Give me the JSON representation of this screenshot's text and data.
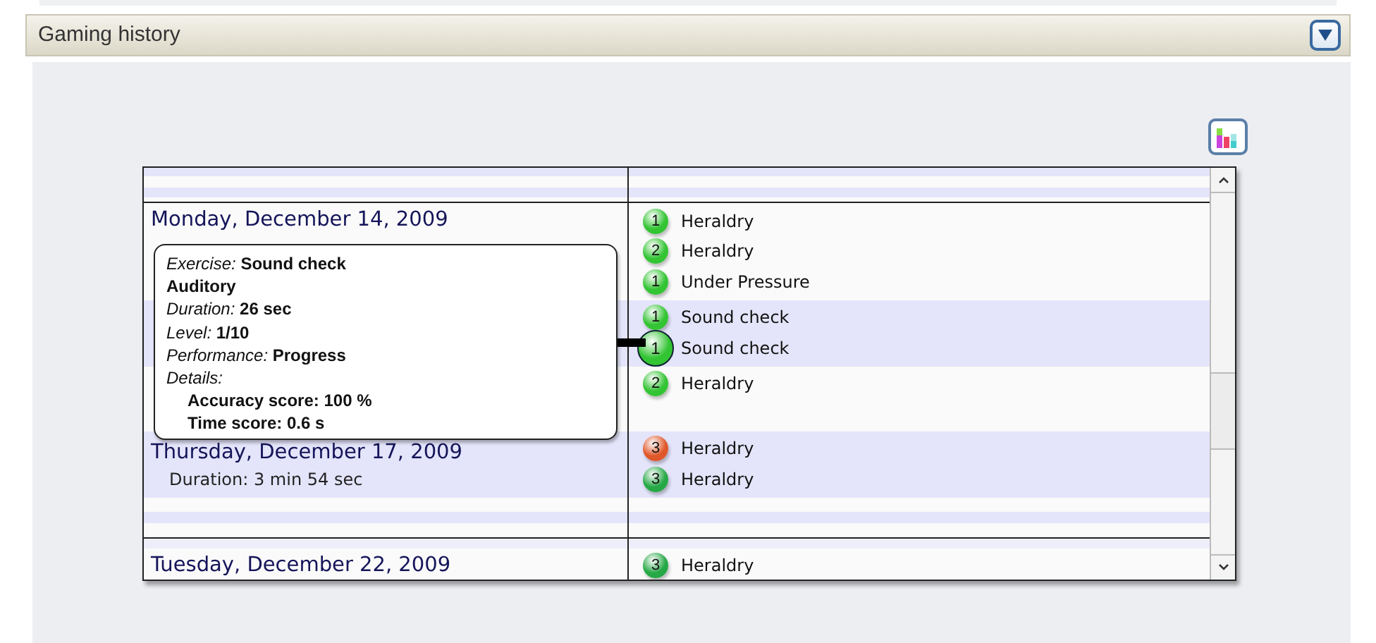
{
  "panel": {
    "title": "Gaming history",
    "expanded": true
  },
  "weeks": [
    {
      "days": [
        {
          "shaded": false,
          "date": "Monday, December 14, 2009",
          "exercises": [
            {
              "level": "1",
              "color": "#33c433",
              "name": "Heraldry",
              "selected": false
            },
            {
              "level": "2",
              "color": "#33c433",
              "name": "Heraldry",
              "selected": false
            },
            {
              "level": "1",
              "color": "#33c433",
              "name": "Under Pressure",
              "selected": false
            }
          ]
        },
        {
          "shaded": true,
          "exercises": [
            {
              "level": "1",
              "color": "#33c433",
              "name": "Sound check",
              "selected": false
            },
            {
              "level": "1",
              "color": "#33c433",
              "name": "Sound check",
              "selected": true
            }
          ]
        },
        {
          "shaded": false,
          "exercises": [
            {
              "level": "2",
              "color": "#33c433",
              "name": "Heraldry",
              "selected": false
            }
          ]
        },
        {
          "shaded": true,
          "date": "Thursday, December 17, 2009",
          "duration": "Duration: 3 min 54 sec",
          "exercises": [
            {
              "level": "3",
              "color": "#e0572a",
              "name": "Heraldry",
              "selected": false
            },
            {
              "level": "3",
              "color": "#25a845",
              "name": "Heraldry",
              "selected": false
            }
          ]
        }
      ]
    },
    {
      "days": [
        {
          "shaded": false,
          "date": "Tuesday, December 22, 2009",
          "exercises": [
            {
              "level": "3",
              "color": "#25a845",
              "name": "Heraldry",
              "selected": false
            }
          ]
        }
      ]
    }
  ],
  "tooltip": {
    "lines": [
      {
        "kind": "field",
        "label": "Exercise:",
        "value": "Sound check"
      },
      {
        "kind": "category",
        "text": "Auditory"
      },
      {
        "kind": "field",
        "label": "Duration:",
        "value": "26 sec"
      },
      {
        "kind": "field",
        "label": "Level:",
        "value": "1/10"
      },
      {
        "kind": "field",
        "label": "Performance:",
        "value": "Progress"
      },
      {
        "kind": "section",
        "text": "Details:"
      },
      {
        "kind": "detail",
        "text": "Accuracy score: 100 %"
      },
      {
        "kind": "detail",
        "text": "Time score: 0.6 s"
      }
    ]
  }
}
